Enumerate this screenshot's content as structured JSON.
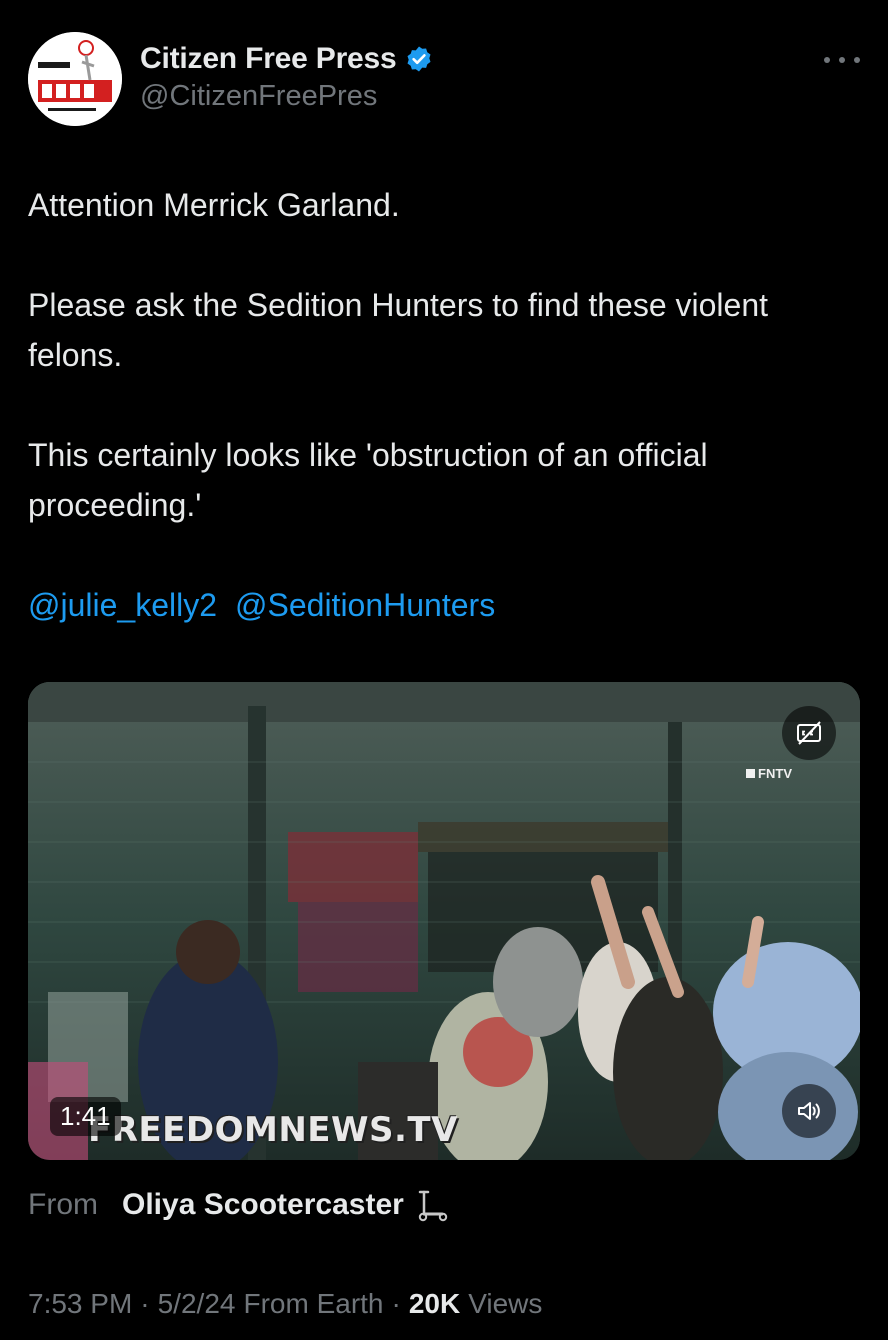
{
  "tweet": {
    "author": {
      "display_name": "Citizen Free Press",
      "handle": "@CitizenFreePres",
      "verified": true,
      "avatar_icon": "citizen-free-press-logo",
      "avatar_text": "CITIZEN FREE PRESS IS NEWS"
    },
    "text": {
      "line1": "Attention Merrick Garland.",
      "line2": "Please ask the Sedition Hunters to find these violent felons.",
      "line3": "This certainly looks like 'obstruction of an official proceeding.'",
      "mentions": [
        "@julie_kelly2",
        "@SeditionHunters"
      ]
    },
    "media": {
      "duration": "1:41",
      "watermark": "FREEDOMNEWS.TV",
      "channel_logo": "FNTV",
      "cc_icon": "captions-off-icon",
      "volume_icon": "volume-icon"
    },
    "attribution": {
      "from_label": "From",
      "author": "Oliya Scootercaster",
      "author_icon": "kick-scooter-icon"
    },
    "meta": {
      "time": "7:53 PM",
      "date": "5/2/24",
      "source": "From Earth",
      "views_count": "20K",
      "views_label": "Views"
    }
  },
  "colors": {
    "background": "#000000",
    "text": "#e7e9ea",
    "secondary_text": "#71767b",
    "link": "#1d9bf0",
    "verified_badge": "#1d9bf0"
  }
}
